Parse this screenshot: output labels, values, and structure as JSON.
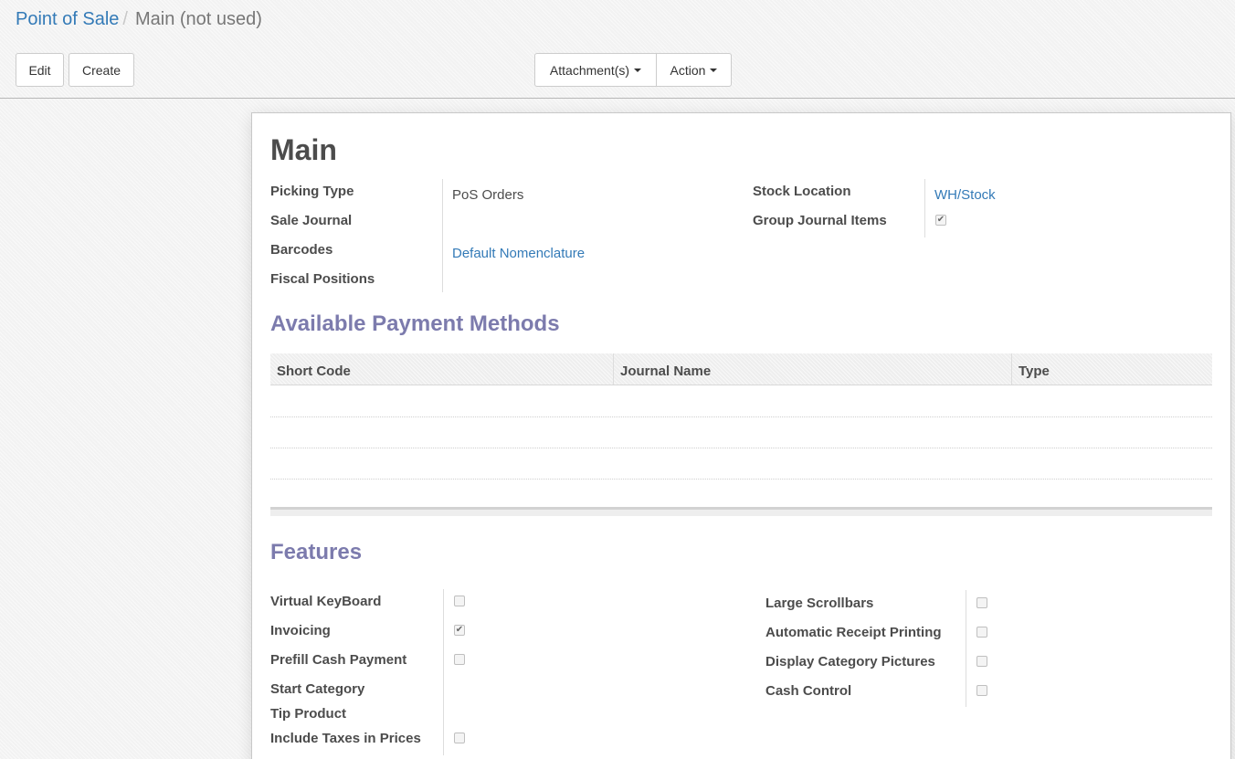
{
  "breadcrumb": {
    "parent": "Point of Sale",
    "separator": "/",
    "current": "Main (not used)"
  },
  "toolbar": {
    "edit_label": "Edit",
    "create_label": "Create",
    "attachments_label": "Attachment(s)",
    "action_label": "Action"
  },
  "form": {
    "title": "Main",
    "left_fields": [
      {
        "label": "Picking Type",
        "value": "PoS Orders"
      },
      {
        "label": "Sale Journal",
        "value": ""
      },
      {
        "label": "Barcodes",
        "value": "Default Nomenclature"
      },
      {
        "label": "Fiscal Positions",
        "value": ""
      }
    ],
    "right_fields": [
      {
        "label": "Stock Location",
        "value": "WH/Stock"
      },
      {
        "label": "Group Journal Items",
        "checked": true
      }
    ]
  },
  "payment_methods": {
    "title": "Available Payment Methods",
    "columns": [
      "Short Code",
      "Journal Name",
      "Type"
    ],
    "rows": []
  },
  "features": {
    "title": "Features",
    "left": [
      {
        "label": "Virtual KeyBoard",
        "checked": false
      },
      {
        "label": "Invoicing",
        "checked": true
      },
      {
        "label": "Prefill Cash Payment",
        "checked": false
      },
      {
        "label": "Start Category",
        "value": ""
      },
      {
        "label": "Tip Product",
        "value": ""
      },
      {
        "label": "Include Taxes in Prices",
        "checked": false
      }
    ],
    "right": [
      {
        "label": "Large Scrollbars",
        "checked": false
      },
      {
        "label": "Automatic Receipt Printing",
        "checked": false
      },
      {
        "label": "Display Category Pictures",
        "checked": false
      },
      {
        "label": "Cash Control",
        "checked": false
      }
    ]
  },
  "colors": {
    "link": "#337ab7",
    "section_title": "#7c7bad",
    "text": "#4c4c4c"
  }
}
